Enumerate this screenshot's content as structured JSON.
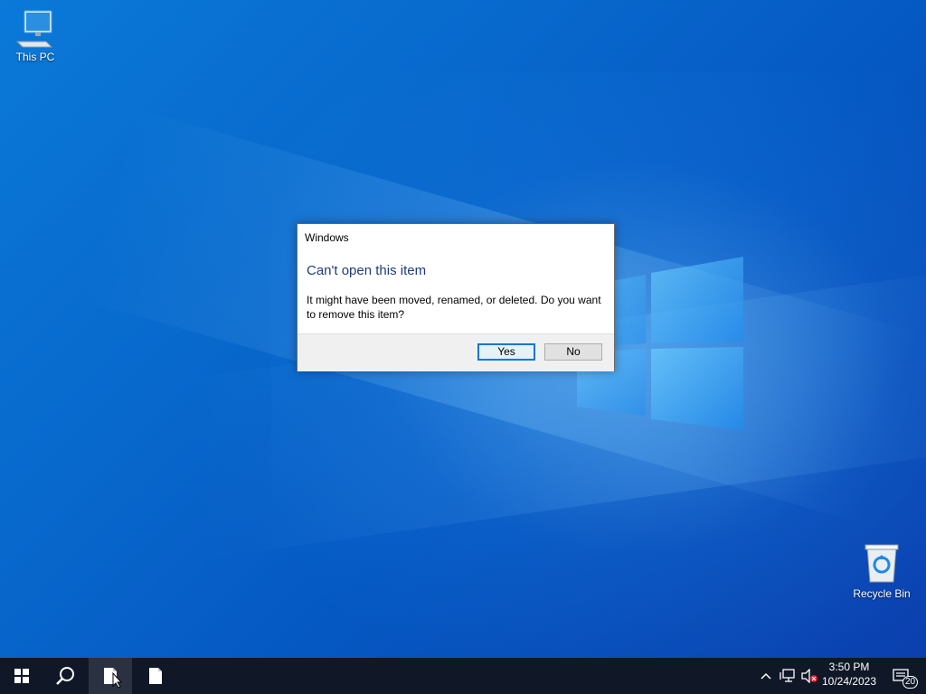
{
  "desktop": {
    "icons": [
      {
        "label": "This PC",
        "icon": "this-pc-icon"
      },
      {
        "label": "Recycle Bin",
        "icon": "recycle-bin-icon"
      }
    ]
  },
  "dialog": {
    "title": "Windows",
    "heading": "Can't open this item",
    "message": "It might have been moved, renamed, or deleted. Do you want to remove this item?",
    "buttons": {
      "yes": "Yes",
      "no": "No"
    }
  },
  "taskbar": {
    "start_icon": "windows-start-icon",
    "search_icon": "search-icon",
    "pinned": [
      "document-icon",
      "document-icon"
    ],
    "tray": {
      "time": "3:50 PM",
      "date": "10/24/2023",
      "notifications_count": "20"
    }
  },
  "colors": {
    "accent": "#0078d7",
    "taskbar": "#101828",
    "heading": "#1f3b7a"
  }
}
